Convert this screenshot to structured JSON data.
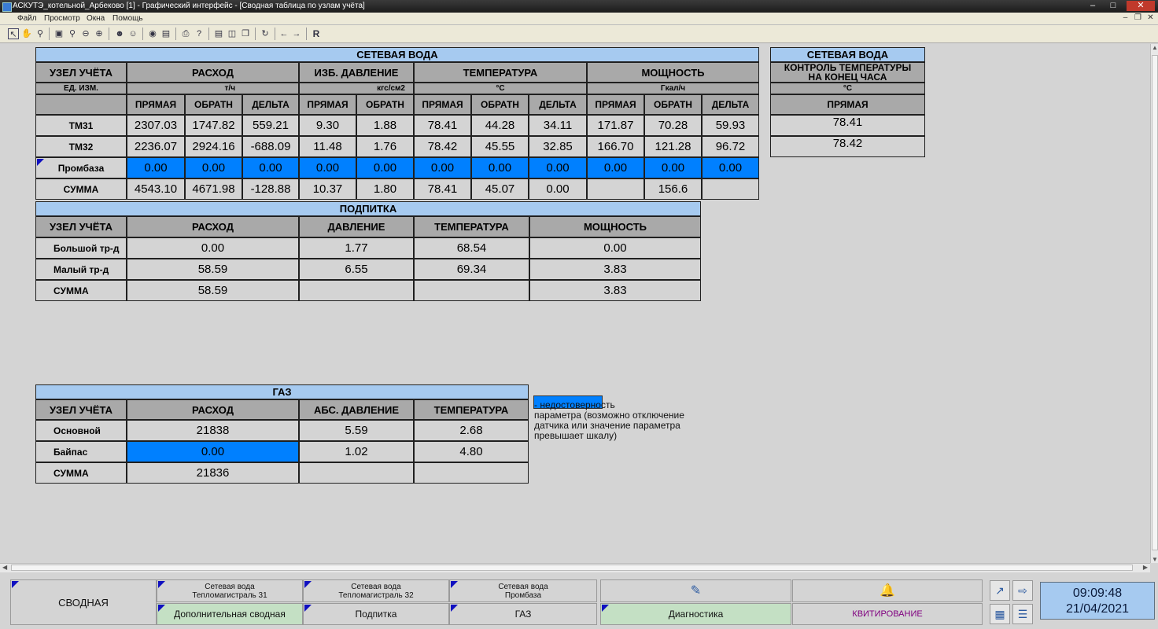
{
  "window": {
    "title": "АСКУТЭ_котельной_Арбеково [1] - Графический интерфейс - [Сводная таблица по узлам учёта]"
  },
  "menu": {
    "items": [
      "Файл",
      "Просмотр",
      "Окна",
      "Помощь"
    ]
  },
  "toolbar": {
    "r_label": "R"
  },
  "network": {
    "caption": "СЕТЕВАЯ ВОДА",
    "h_node": "УЗЕЛ УЧЁТА",
    "h_flow": "РАСХОД",
    "h_pressure": "ИЗБ. ДАВЛЕНИЕ",
    "h_temp": "ТЕМПЕРАТУРА",
    "h_power": "МОЩНОСТЬ",
    "u_label": "ЕД. ИЗМ.",
    "u_flow": "т/ч",
    "u_pressure": "кгс/см2",
    "u_temp": "°C",
    "u_power": "Гкал/ч",
    "sub": [
      "ПРЯМАЯ",
      "ОБРАТН",
      "ДЕЛЬТА",
      "ПРЯМАЯ",
      "ОБРАТН",
      "ПРЯМАЯ",
      "ОБРАТН",
      "ДЕЛЬТА",
      "ПРЯМАЯ",
      "ОБРАТН",
      "ДЕЛЬТА"
    ],
    "rows": [
      {
        "name": "ТМ31",
        "values": [
          "2307.03",
          "1747.82",
          "559.21",
          "9.30",
          "1.88",
          "78.41",
          "44.28",
          "34.11",
          "171.87",
          "70.28",
          "59.93"
        ],
        "bad": false
      },
      {
        "name": "ТМ32",
        "values": [
          "2236.07",
          "2924.16",
          "-688.09",
          "11.48",
          "1.76",
          "78.42",
          "45.55",
          "32.85",
          "166.70",
          "121.28",
          "96.72"
        ],
        "bad": false
      },
      {
        "name": "Промбаза",
        "values": [
          "0.00",
          "0.00",
          "0.00",
          "0.00",
          "0.00",
          "0.00",
          "0.00",
          "0.00",
          "0.00",
          "0.00",
          "0.00"
        ],
        "bad": true
      },
      {
        "name": "СУММА",
        "values": [
          "4543.10",
          "4671.98",
          "-128.88",
          "10.37",
          "1.80",
          "78.41",
          "45.07",
          "0.00",
          "",
          "156.6",
          ""
        ],
        "bad": false
      }
    ]
  },
  "control": {
    "caption": "СЕТЕВАЯ ВОДА",
    "h_title": "КОНТРОЛЬ ТЕМПЕРАТУРЫ\nНА КОНЕЦ ЧАСА",
    "unit": "°C",
    "h_sub": "ПРЯМАЯ",
    "values": [
      "78.41",
      "78.42"
    ]
  },
  "makeup": {
    "caption": "ПОДПИТКА",
    "headers": [
      "УЗЕЛ УЧЁТА",
      "РАСХОД",
      "ДАВЛЕНИЕ",
      "ТЕМПЕРАТУРА",
      "МОЩНОСТЬ"
    ],
    "rows": [
      {
        "name": "Большой тр-д",
        "values": [
          "0.00",
          "1.77",
          "68.54",
          "0.00"
        ]
      },
      {
        "name": "Малый тр-д",
        "values": [
          "58.59",
          "6.55",
          "69.34",
          "3.83"
        ]
      },
      {
        "name": "СУММА",
        "values": [
          "58.59",
          "",
          "",
          "3.83"
        ]
      }
    ]
  },
  "gas": {
    "caption": "ГАЗ",
    "headers": [
      "УЗЕЛ УЧЁТА",
      "РАСХОД",
      "АБС. ДАВЛЕНИЕ",
      "ТЕМПЕРАТУРА"
    ],
    "rows": [
      {
        "name": "Основной",
        "values": [
          "21838",
          "5.59",
          "2.68"
        ],
        "bad": [
          false,
          false,
          false
        ]
      },
      {
        "name": "Байпас",
        "values": [
          "0.00",
          "1.02",
          "4.80"
        ],
        "bad": [
          true,
          false,
          false
        ]
      },
      {
        "name": "СУММА",
        "values": [
          "21836",
          "",
          ""
        ],
        "bad": [
          false,
          false,
          false
        ]
      }
    ]
  },
  "legend": {
    "text": "                         -  недостоверность\nпараметра (возможно отключение\nдатчика или значение параметра\nпревышает шкалу)"
  },
  "nav": {
    "summary": "СВОДНАЯ",
    "tm31": "Сетевая вода\nТепломагистраль 31",
    "tm32": "Сетевая вода\nТепломагистраль 32",
    "prombaza": "Сетевая вода\nПромбаза",
    "extra": "Дополнительная сводная",
    "makeup": "Подпитка",
    "gas": "ГАЗ",
    "diag": "Диагностика",
    "ack": "КВИТИРОВАНИЕ"
  },
  "clock": {
    "time": "09:09:48",
    "date": "21/04/2021"
  },
  "colors": {
    "invalid": "#0080ff",
    "caption": "#a6caf0",
    "header": "#a9a9a9",
    "nav_green": "#c4e0c4",
    "ack_text": "#800080"
  }
}
